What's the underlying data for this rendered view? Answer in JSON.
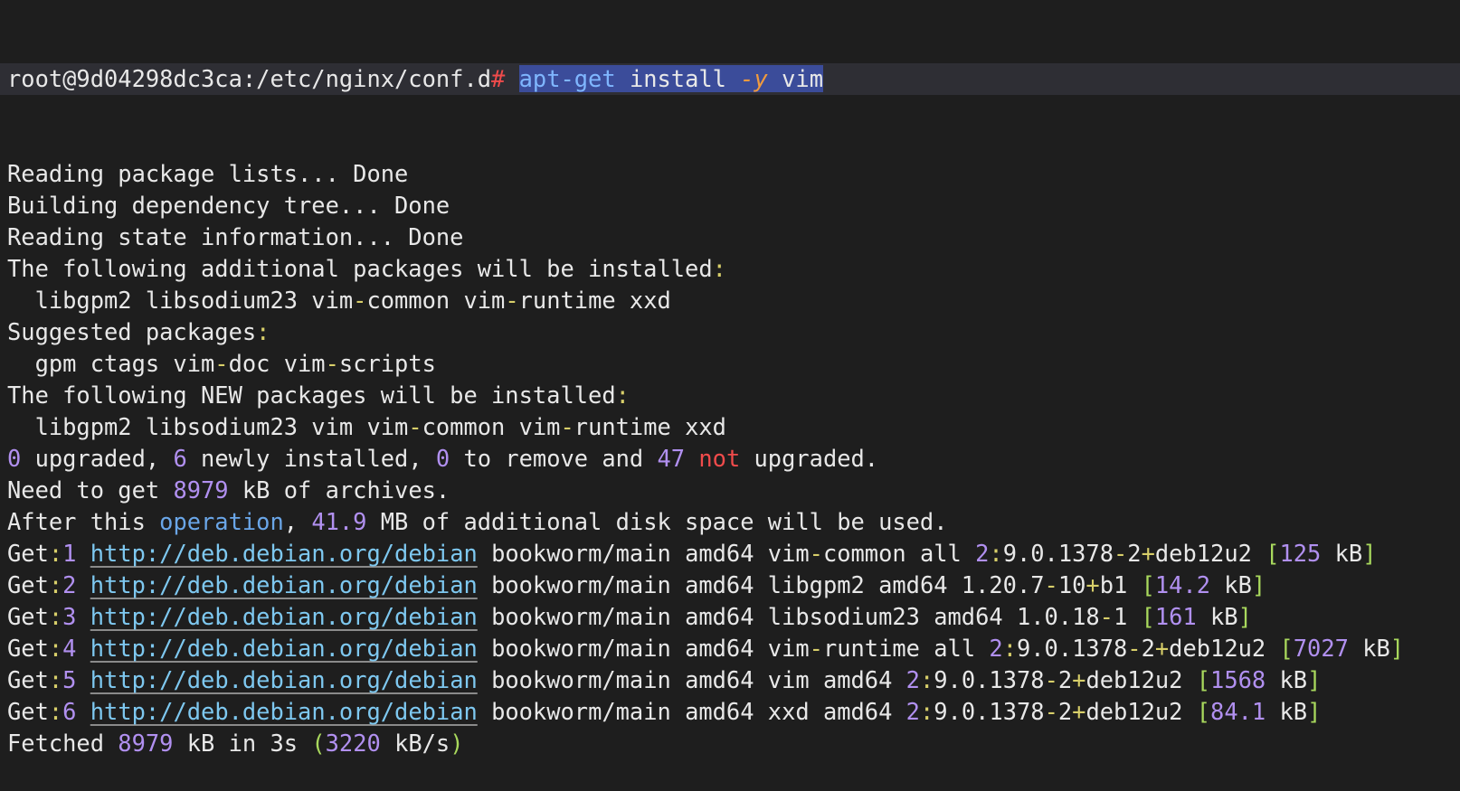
{
  "prompt": {
    "user_host_path": "root@9d04298dc3ca:/etc/nginx/conf.d",
    "symbol": "#",
    "command": "apt-get",
    "arg1": "install",
    "flag": "-y",
    "arg2": "vim"
  },
  "output_lines": [
    [
      {
        "t": "Reading package lists... Done",
        "c": "w"
      }
    ],
    [
      {
        "t": "Building dependency tree... Done",
        "c": "w"
      }
    ],
    [
      {
        "t": "Reading state information... Done",
        "c": "w"
      }
    ],
    [
      {
        "t": "The following additional packages will be installed",
        "c": "w"
      },
      {
        "t": ":",
        "c": "y"
      }
    ],
    [
      {
        "t": "  libgpm2 libsodium23 vim",
        "c": "w"
      },
      {
        "t": "-",
        "c": "y"
      },
      {
        "t": "common vim",
        "c": "w"
      },
      {
        "t": "-",
        "c": "y"
      },
      {
        "t": "runtime xxd",
        "c": "w"
      }
    ],
    [
      {
        "t": "Suggested packages",
        "c": "w"
      },
      {
        "t": ":",
        "c": "y"
      }
    ],
    [
      {
        "t": "  gpm ctags vim",
        "c": "w"
      },
      {
        "t": "-",
        "c": "y"
      },
      {
        "t": "doc vim",
        "c": "w"
      },
      {
        "t": "-",
        "c": "y"
      },
      {
        "t": "scripts",
        "c": "w"
      }
    ],
    [
      {
        "t": "The following NEW packages will be installed",
        "c": "w"
      },
      {
        "t": ":",
        "c": "y"
      }
    ],
    [
      {
        "t": "  libgpm2 libsodium23 vim vim",
        "c": "w"
      },
      {
        "t": "-",
        "c": "y"
      },
      {
        "t": "common vim",
        "c": "w"
      },
      {
        "t": "-",
        "c": "y"
      },
      {
        "t": "runtime xxd",
        "c": "w"
      }
    ],
    [
      {
        "t": "0",
        "c": "p"
      },
      {
        "t": " upgraded, ",
        "c": "w"
      },
      {
        "t": "6",
        "c": "p"
      },
      {
        "t": " newly installed, ",
        "c": "w"
      },
      {
        "t": "0",
        "c": "p"
      },
      {
        "t": " to remove and ",
        "c": "w"
      },
      {
        "t": "47",
        "c": "p"
      },
      {
        "t": " ",
        "c": "w"
      },
      {
        "t": "not",
        "c": "r"
      },
      {
        "t": " upgraded.",
        "c": "w"
      }
    ],
    [
      {
        "t": "Need to get ",
        "c": "w"
      },
      {
        "t": "8979",
        "c": "p"
      },
      {
        "t": " kB of archives.",
        "c": "w"
      }
    ],
    [
      {
        "t": "After this ",
        "c": "w"
      },
      {
        "t": "operation",
        "c": "b"
      },
      {
        "t": ", ",
        "c": "w"
      },
      {
        "t": "41.9",
        "c": "p"
      },
      {
        "t": " MB of additional disk space will be used.",
        "c": "w"
      }
    ],
    [
      {
        "t": "Get",
        "c": "w"
      },
      {
        "t": ":",
        "c": "y"
      },
      {
        "t": "1",
        "c": "p"
      },
      {
        "t": " ",
        "c": "w"
      },
      {
        "t": "http://deb.debian.org/debian",
        "c": "link"
      },
      {
        "t": " bookworm/main amd64 vim",
        "c": "w"
      },
      {
        "t": "-",
        "c": "y"
      },
      {
        "t": "common all ",
        "c": "w"
      },
      {
        "t": "2",
        "c": "p"
      },
      {
        "t": ":",
        "c": "y"
      },
      {
        "t": "9.0.1378",
        "c": "w"
      },
      {
        "t": "-",
        "c": "y"
      },
      {
        "t": "2",
        "c": "w"
      },
      {
        "t": "+",
        "c": "y"
      },
      {
        "t": "deb12u2 ",
        "c": "w"
      },
      {
        "t": "[",
        "c": "g"
      },
      {
        "t": "125",
        "c": "p"
      },
      {
        "t": " kB",
        "c": "w"
      },
      {
        "t": "]",
        "c": "g"
      }
    ],
    [
      {
        "t": "Get",
        "c": "w"
      },
      {
        "t": ":",
        "c": "y"
      },
      {
        "t": "2",
        "c": "p"
      },
      {
        "t": " ",
        "c": "w"
      },
      {
        "t": "http://deb.debian.org/debian",
        "c": "link"
      },
      {
        "t": " bookworm/main amd64 libgpm2 amd64 1.20.7",
        "c": "w"
      },
      {
        "t": "-",
        "c": "y"
      },
      {
        "t": "10",
        "c": "w"
      },
      {
        "t": "+",
        "c": "y"
      },
      {
        "t": "b1 ",
        "c": "w"
      },
      {
        "t": "[",
        "c": "g"
      },
      {
        "t": "14.2",
        "c": "p"
      },
      {
        "t": " kB",
        "c": "w"
      },
      {
        "t": "]",
        "c": "g"
      }
    ],
    [
      {
        "t": "Get",
        "c": "w"
      },
      {
        "t": ":",
        "c": "y"
      },
      {
        "t": "3",
        "c": "p"
      },
      {
        "t": " ",
        "c": "w"
      },
      {
        "t": "http://deb.debian.org/debian",
        "c": "link"
      },
      {
        "t": " bookworm/main amd64 libsodium23 amd64 1.0.18",
        "c": "w"
      },
      {
        "t": "-",
        "c": "y"
      },
      {
        "t": "1 ",
        "c": "w"
      },
      {
        "t": "[",
        "c": "g"
      },
      {
        "t": "161",
        "c": "p"
      },
      {
        "t": " kB",
        "c": "w"
      },
      {
        "t": "]",
        "c": "g"
      }
    ],
    [
      {
        "t": "Get",
        "c": "w"
      },
      {
        "t": ":",
        "c": "y"
      },
      {
        "t": "4",
        "c": "p"
      },
      {
        "t": " ",
        "c": "w"
      },
      {
        "t": "http://deb.debian.org/debian",
        "c": "link"
      },
      {
        "t": " bookworm/main amd64 vim",
        "c": "w"
      },
      {
        "t": "-",
        "c": "y"
      },
      {
        "t": "runtime all ",
        "c": "w"
      },
      {
        "t": "2",
        "c": "p"
      },
      {
        "t": ":",
        "c": "y"
      },
      {
        "t": "9.0.1378",
        "c": "w"
      },
      {
        "t": "-",
        "c": "y"
      },
      {
        "t": "2",
        "c": "w"
      },
      {
        "t": "+",
        "c": "y"
      },
      {
        "t": "deb12u2 ",
        "c": "w"
      },
      {
        "t": "[",
        "c": "g"
      },
      {
        "t": "7027",
        "c": "p"
      },
      {
        "t": " kB",
        "c": "w"
      },
      {
        "t": "]",
        "c": "g"
      }
    ],
    [
      {
        "t": "Get",
        "c": "w"
      },
      {
        "t": ":",
        "c": "y"
      },
      {
        "t": "5",
        "c": "p"
      },
      {
        "t": " ",
        "c": "w"
      },
      {
        "t": "http://deb.debian.org/debian",
        "c": "link"
      },
      {
        "t": " bookworm/main amd64 vim amd64 ",
        "c": "w"
      },
      {
        "t": "2",
        "c": "p"
      },
      {
        "t": ":",
        "c": "y"
      },
      {
        "t": "9.0.1378",
        "c": "w"
      },
      {
        "t": "-",
        "c": "y"
      },
      {
        "t": "2",
        "c": "w"
      },
      {
        "t": "+",
        "c": "y"
      },
      {
        "t": "deb12u2 ",
        "c": "w"
      },
      {
        "t": "[",
        "c": "g"
      },
      {
        "t": "1568",
        "c": "p"
      },
      {
        "t": " kB",
        "c": "w"
      },
      {
        "t": "]",
        "c": "g"
      }
    ],
    [
      {
        "t": "Get",
        "c": "w"
      },
      {
        "t": ":",
        "c": "y"
      },
      {
        "t": "6",
        "c": "p"
      },
      {
        "t": " ",
        "c": "w"
      },
      {
        "t": "http://deb.debian.org/debian",
        "c": "link"
      },
      {
        "t": " bookworm/main amd64 xxd amd64 ",
        "c": "w"
      },
      {
        "t": "2",
        "c": "p"
      },
      {
        "t": ":",
        "c": "y"
      },
      {
        "t": "9.0.1378",
        "c": "w"
      },
      {
        "t": "-",
        "c": "y"
      },
      {
        "t": "2",
        "c": "w"
      },
      {
        "t": "+",
        "c": "y"
      },
      {
        "t": "deb12u2 ",
        "c": "w"
      },
      {
        "t": "[",
        "c": "g"
      },
      {
        "t": "84.1",
        "c": "p"
      },
      {
        "t": " kB",
        "c": "w"
      },
      {
        "t": "]",
        "c": "g"
      }
    ],
    [
      {
        "t": "Fetched ",
        "c": "w"
      },
      {
        "t": "8979",
        "c": "p"
      },
      {
        "t": " kB in 3s ",
        "c": "w"
      },
      {
        "t": "(",
        "c": "g"
      },
      {
        "t": "3220",
        "c": "p"
      },
      {
        "t": " kB/s",
        "c": "w"
      },
      {
        "t": ")",
        "c": "g"
      }
    ]
  ],
  "colors": {
    "background": "#1e1e1e",
    "prompt_bar": "#2e2e34",
    "text": "#e8e8e8",
    "punctuation": "#d8cf6a",
    "number": "#b190f0",
    "keyword_not": "#f04b4b",
    "keyword_operation": "#6aa6e8",
    "bracket": "#a9d95d",
    "link": "#7ec8f0",
    "selection": "#3b4c9a"
  }
}
